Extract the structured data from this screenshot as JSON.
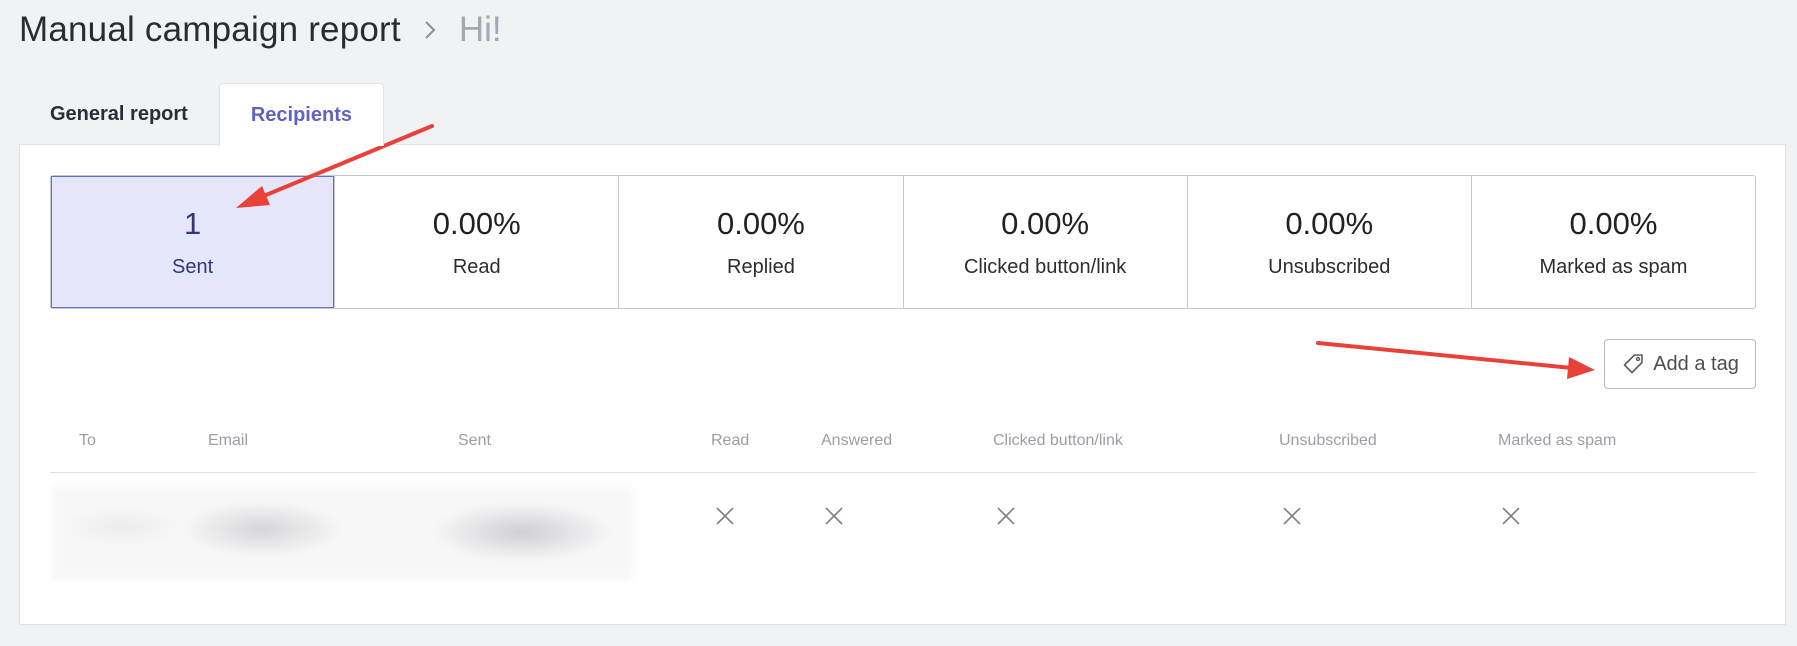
{
  "header": {
    "title": "Manual campaign report",
    "subtitle": "Hi!"
  },
  "tabs": [
    {
      "label": "General report",
      "active": false
    },
    {
      "label": "Recipients",
      "active": true
    }
  ],
  "stats": [
    {
      "value": "1",
      "label": "Sent",
      "active": true
    },
    {
      "value": "0.00%",
      "label": "Read",
      "active": false
    },
    {
      "value": "0.00%",
      "label": "Replied",
      "active": false
    },
    {
      "value": "0.00%",
      "label": "Clicked button/link",
      "active": false
    },
    {
      "value": "0.00%",
      "label": "Unsubscribed",
      "active": false
    },
    {
      "value": "0.00%",
      "label": "Marked as spam",
      "active": false
    }
  ],
  "tag_button": {
    "label": "Add a tag",
    "icon": "tag-icon"
  },
  "table": {
    "columns": [
      "To",
      "Email",
      "Sent",
      "Read",
      "Answered",
      "Clicked button/link",
      "Unsubscribed",
      "Marked as spam"
    ],
    "rows": [
      {
        "read": false,
        "answered": false,
        "clicked": false,
        "unsubscribed": false,
        "spam": false
      }
    ]
  },
  "colors": {
    "accent": "#5f63c4",
    "active_stat_bg": "#e5e6fa",
    "annotation_arrow": "#e8413a"
  }
}
